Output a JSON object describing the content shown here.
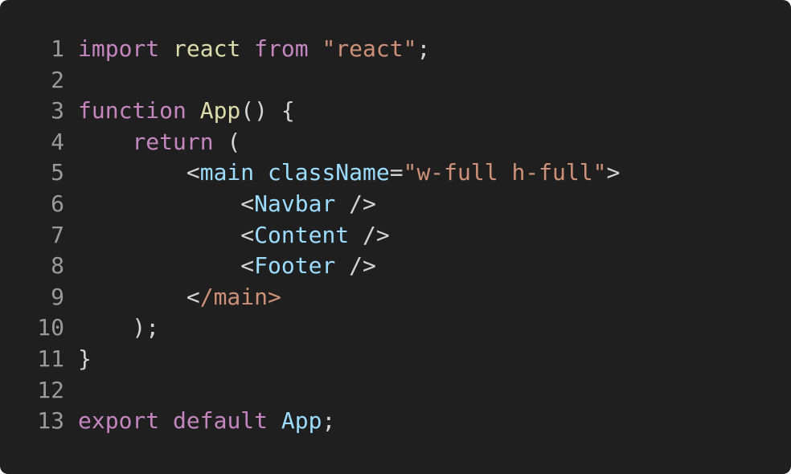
{
  "colors": {
    "background": "#1f1f1f",
    "line_number": "#9a9a9a",
    "keyword": "#c586c0",
    "identifier": "#dcdcaa",
    "string": "#ce9178",
    "punct": "#d4d4d4",
    "tag": "#9cdcfe"
  },
  "lines": [
    {
      "num": "1",
      "tokens": [
        {
          "t": "import",
          "c": "keyword"
        },
        {
          "t": " ",
          "c": "punct"
        },
        {
          "t": "react",
          "c": "identifier"
        },
        {
          "t": " ",
          "c": "punct"
        },
        {
          "t": "from",
          "c": "keyword"
        },
        {
          "t": " ",
          "c": "punct"
        },
        {
          "t": "\"react\"",
          "c": "string"
        },
        {
          "t": ";",
          "c": "punct"
        }
      ]
    },
    {
      "num": "2",
      "tokens": []
    },
    {
      "num": "3",
      "tokens": [
        {
          "t": "function",
          "c": "keyword"
        },
        {
          "t": " ",
          "c": "punct"
        },
        {
          "t": "App",
          "c": "identifier"
        },
        {
          "t": "() {",
          "c": "punct"
        }
      ]
    },
    {
      "num": "4",
      "tokens": [
        {
          "t": "    ",
          "c": "punct"
        },
        {
          "t": "return",
          "c": "keyword"
        },
        {
          "t": " (",
          "c": "punct"
        }
      ]
    },
    {
      "num": "5",
      "tokens": [
        {
          "t": "        <",
          "c": "punct"
        },
        {
          "t": "main",
          "c": "tag"
        },
        {
          "t": " ",
          "c": "punct"
        },
        {
          "t": "className",
          "c": "tag"
        },
        {
          "t": "=",
          "c": "punct"
        },
        {
          "t": "\"w-full h-full\"",
          "c": "string"
        },
        {
          "t": ">",
          "c": "punct"
        }
      ]
    },
    {
      "num": "6",
      "tokens": [
        {
          "t": "            <",
          "c": "punct"
        },
        {
          "t": "Navbar",
          "c": "tag"
        },
        {
          "t": " />",
          "c": "punct"
        }
      ]
    },
    {
      "num": "7",
      "tokens": [
        {
          "t": "            <",
          "c": "punct"
        },
        {
          "t": "Content",
          "c": "tag"
        },
        {
          "t": " />",
          "c": "punct"
        }
      ]
    },
    {
      "num": "8",
      "tokens": [
        {
          "t": "            <",
          "c": "punct"
        },
        {
          "t": "Footer",
          "c": "tag"
        },
        {
          "t": " />",
          "c": "punct"
        }
      ]
    },
    {
      "num": "9",
      "tokens": [
        {
          "t": "        <",
          "c": "punct"
        },
        {
          "t": "/main>",
          "c": "string"
        }
      ]
    },
    {
      "num": "10",
      "tokens": [
        {
          "t": "    );",
          "c": "punct"
        }
      ]
    },
    {
      "num": "11",
      "tokens": [
        {
          "t": "}",
          "c": "punct"
        }
      ]
    },
    {
      "num": "12",
      "tokens": []
    },
    {
      "num": "13",
      "tokens": [
        {
          "t": "export",
          "c": "keyword"
        },
        {
          "t": " ",
          "c": "punct"
        },
        {
          "t": "default",
          "c": "keyword"
        },
        {
          "t": " ",
          "c": "punct"
        },
        {
          "t": "App",
          "c": "tag"
        },
        {
          "t": ";",
          "c": "punct"
        }
      ]
    }
  ]
}
